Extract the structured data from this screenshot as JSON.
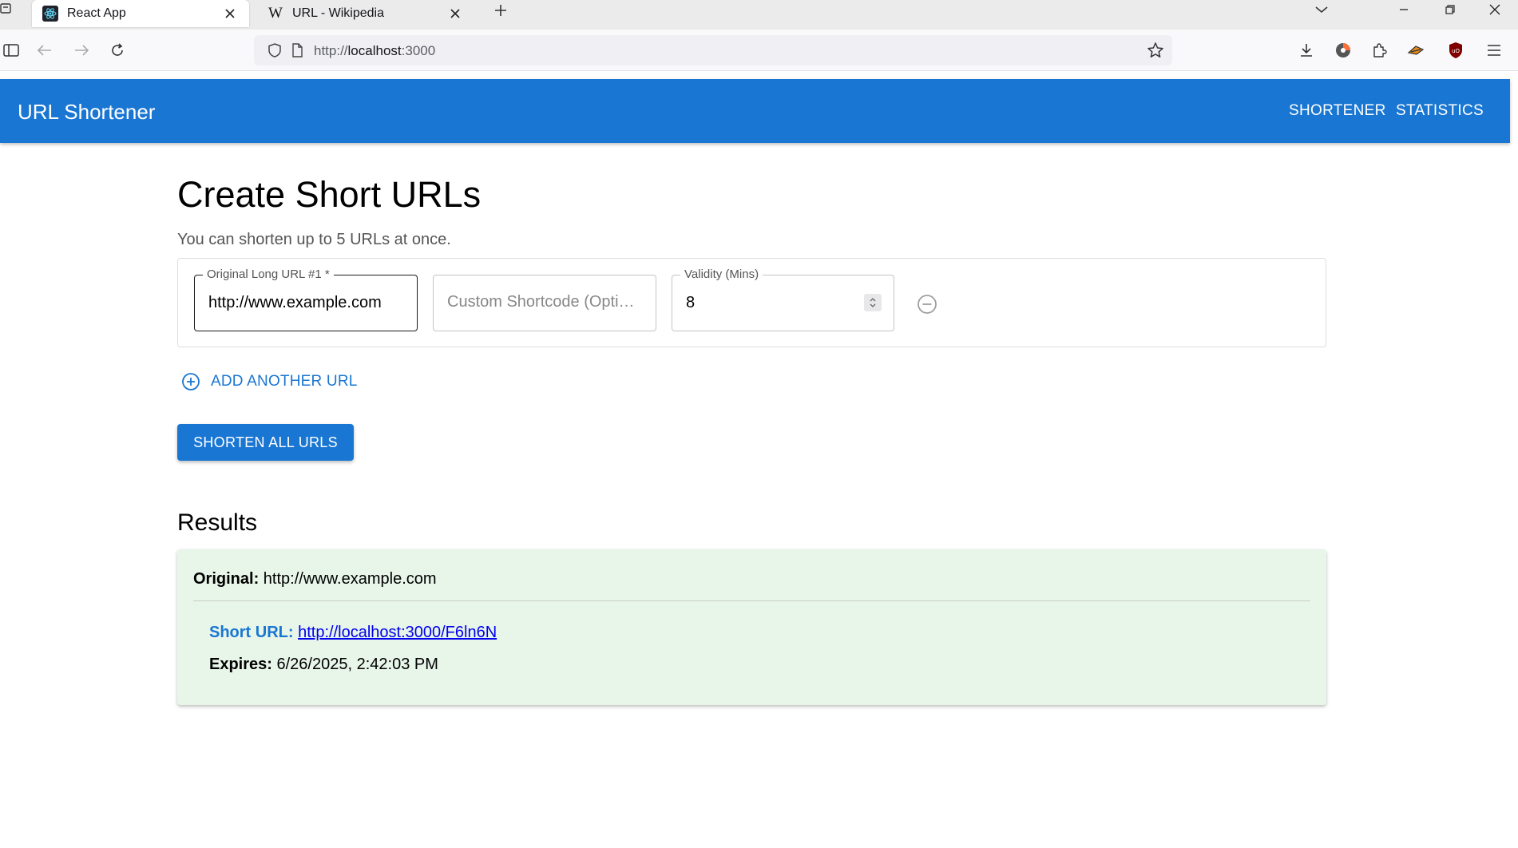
{
  "browser": {
    "tabs": [
      {
        "title": "React App",
        "icon": "react-icon",
        "active": true
      },
      {
        "title": "URL - Wikipedia",
        "icon": "wikipedia-icon",
        "active": false
      }
    ],
    "address": {
      "scheme": "http://",
      "host": "localhost",
      "port": ":3000"
    }
  },
  "app": {
    "brand": "URL Shortener",
    "nav": {
      "shortener": "SHORTENER",
      "statistics": "STATISTICS"
    },
    "accent": "#1976d2"
  },
  "form": {
    "title": "Create Short URLs",
    "subtitle": "You can shorten up to 5 URLs at once.",
    "rows": [
      {
        "url_label": "Original Long URL #1 *",
        "url_value": "http://www.example.com",
        "shortcode_placeholder": "Custom Shortcode (Opti…",
        "validity_label": "Validity (Mins)",
        "validity_value": "8"
      }
    ],
    "add_label": "ADD ANOTHER URL",
    "submit_label": "SHORTEN ALL URLS"
  },
  "results": {
    "title": "Results",
    "items": [
      {
        "original_label": "Original:",
        "original_value": "http://www.example.com",
        "short_label": "Short URL:",
        "short_value": "http://localhost:3000/F6ln6N",
        "expires_label": "Expires:",
        "expires_value": "6/26/2025, 2:42:03 PM",
        "background": "#e8f5e9"
      }
    ]
  }
}
